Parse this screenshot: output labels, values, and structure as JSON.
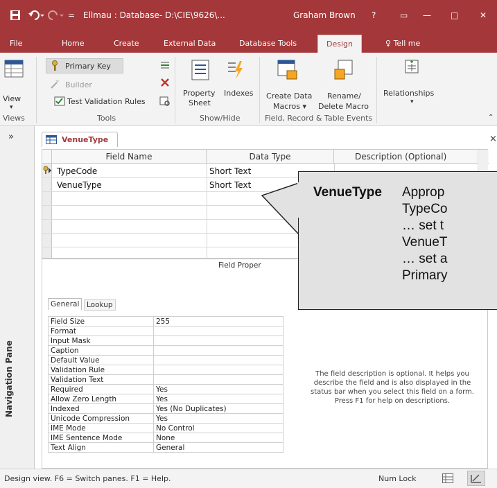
{
  "titlebar": {
    "title": "Ellmau : Database- D:\\CIE\\9626\\...",
    "user": "Graham Brown",
    "help": "?",
    "minimize": "—",
    "maximize": "□",
    "close": "✕"
  },
  "tabs": [
    "File",
    "Home",
    "Create",
    "External Data",
    "Database Tools",
    "Design"
  ],
  "tellme": "Tell me",
  "ribbon": {
    "view": "View",
    "views_group": "Views",
    "primary_key": "Primary Key",
    "builder": "Builder",
    "test_validation": "Test Validation Rules",
    "tools_group": "Tools",
    "property_sheet_1": "Property",
    "property_sheet_2": "Sheet",
    "indexes": "Indexes",
    "showhide_group": "Show/Hide",
    "create_data_1": "Create Data",
    "create_data_2": "Macros ▾",
    "rename_1": "Rename/",
    "rename_2": "Delete Macro",
    "events_group": "Field, Record & Table Events",
    "relationships": "Relationships"
  },
  "nav": {
    "expand": "»",
    "label": "Navigation Pane"
  },
  "doc": {
    "tab": "VenueType",
    "close": "×"
  },
  "grid": {
    "headers": [
      "Field Name",
      "Data Type",
      "Description (Optional)"
    ],
    "rows": [
      {
        "name": "TypeCode",
        "type": "Short Text"
      },
      {
        "name": "VenueType",
        "type": "Short Text"
      }
    ]
  },
  "field_properties": {
    "title": "Field Proper",
    "tabs": [
      "General",
      "Lookup"
    ],
    "props": [
      [
        "Field Size",
        "255"
      ],
      [
        "Format",
        ""
      ],
      [
        "Input Mask",
        ""
      ],
      [
        "Caption",
        ""
      ],
      [
        "Default Value",
        ""
      ],
      [
        "Validation Rule",
        ""
      ],
      [
        "Validation Text",
        ""
      ],
      [
        "Required",
        "Yes"
      ],
      [
        "Allow Zero Length",
        "Yes"
      ],
      [
        "Indexed",
        "Yes (No Duplicates)"
      ],
      [
        "Unicode Compression",
        "Yes"
      ],
      [
        "IME Mode",
        "No Control"
      ],
      [
        "IME Sentence Mode",
        "None"
      ],
      [
        "Text Align",
        "General"
      ]
    ],
    "help_1": "The field description is optional. It helps you",
    "help_2": "describe the field and is also displayed in the",
    "help_3": "status bar when you select this field on a form.",
    "help_4": "Press F1 for help on descriptions."
  },
  "callout": {
    "title": "VenueType",
    "line1": "Approp",
    "line2": "TypeCo",
    "line3": "… set t",
    "line4": "VenueT",
    "line5": "… set a",
    "line6": "Primary"
  },
  "status": {
    "text": "Design view.  F6 = Switch panes.  F1 = Help.",
    "numlock": "Num Lock"
  }
}
